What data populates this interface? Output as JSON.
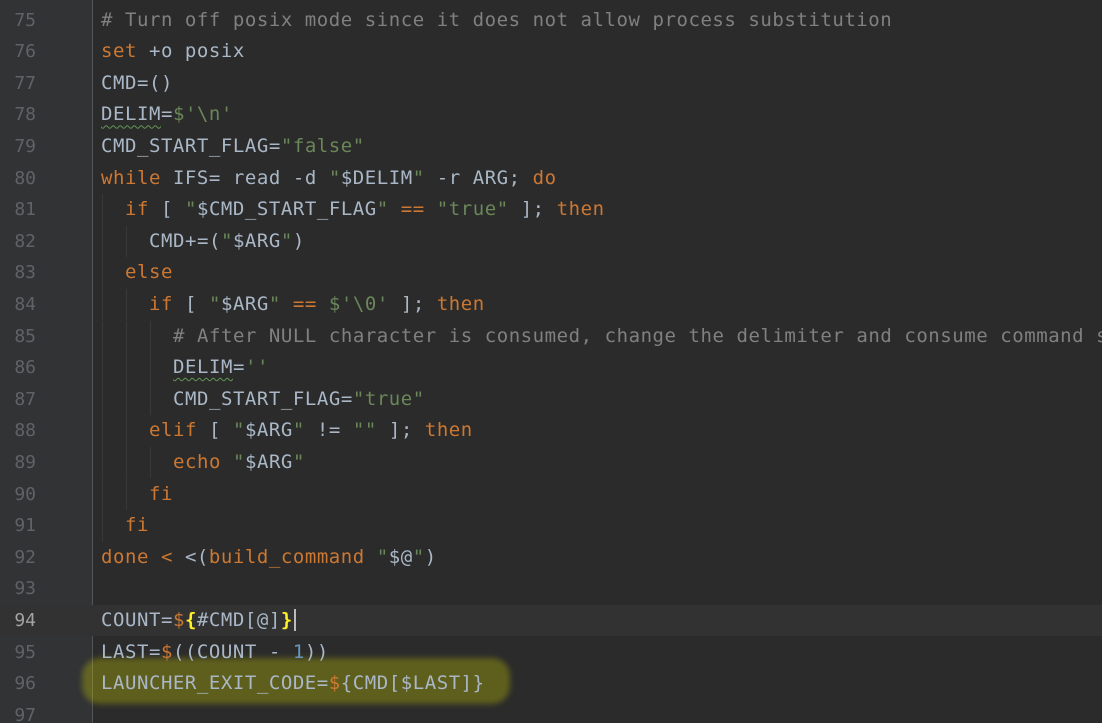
{
  "editor": {
    "lines": [
      {
        "num": "75",
        "indent": 0,
        "current": false,
        "tokens": [
          {
            "t": "# Turn off posix mode since it does not allow process substitution",
            "c": "comment"
          }
        ]
      },
      {
        "num": "76",
        "indent": 0,
        "current": false,
        "tokens": [
          {
            "t": "set",
            "c": "kw"
          },
          {
            "t": " +o posix",
            "c": "plain"
          }
        ]
      },
      {
        "num": "77",
        "indent": 0,
        "current": false,
        "tokens": [
          {
            "t": "CMD=()",
            "c": "plain"
          }
        ]
      },
      {
        "num": "78",
        "indent": 0,
        "current": false,
        "tokens": [
          {
            "t": "DELIM",
            "c": "warn"
          },
          {
            "t": "=",
            "c": "plain"
          },
          {
            "t": "$'\\n'",
            "c": "str"
          }
        ]
      },
      {
        "num": "79",
        "indent": 0,
        "current": false,
        "tokens": [
          {
            "t": "CMD_START_FLAG=",
            "c": "plain"
          },
          {
            "t": "\"false\"",
            "c": "str"
          }
        ]
      },
      {
        "num": "80",
        "indent": 0,
        "current": false,
        "tokens": [
          {
            "t": "while",
            "c": "kw"
          },
          {
            "t": " IFS= read -d ",
            "c": "plain"
          },
          {
            "t": "\"",
            "c": "str"
          },
          {
            "t": "$DELIM",
            "c": "plain"
          },
          {
            "t": "\"",
            "c": "str"
          },
          {
            "t": " -r ARG; ",
            "c": "plain"
          },
          {
            "t": "do",
            "c": "kw"
          }
        ]
      },
      {
        "num": "81",
        "indent": 1,
        "current": false,
        "tokens": [
          {
            "t": "if",
            "c": "kw"
          },
          {
            "t": " [ ",
            "c": "plain"
          },
          {
            "t": "\"",
            "c": "str"
          },
          {
            "t": "$CMD_START_FLAG",
            "c": "plain"
          },
          {
            "t": "\"",
            "c": "str"
          },
          {
            "t": " == ",
            "c": "kw"
          },
          {
            "t": "\"true\"",
            "c": "str"
          },
          {
            "t": " ]; ",
            "c": "plain"
          },
          {
            "t": "then",
            "c": "kw"
          }
        ]
      },
      {
        "num": "82",
        "indent": 2,
        "current": false,
        "tokens": [
          {
            "t": "CMD+=(",
            "c": "plain"
          },
          {
            "t": "\"",
            "c": "str"
          },
          {
            "t": "$ARG",
            "c": "plain"
          },
          {
            "t": "\"",
            "c": "str"
          },
          {
            "t": ")",
            "c": "plain"
          }
        ]
      },
      {
        "num": "83",
        "indent": 1,
        "current": false,
        "tokens": [
          {
            "t": "else",
            "c": "kw"
          }
        ]
      },
      {
        "num": "84",
        "indent": 2,
        "current": false,
        "tokens": [
          {
            "t": "if",
            "c": "kw"
          },
          {
            "t": " [ ",
            "c": "plain"
          },
          {
            "t": "\"",
            "c": "str"
          },
          {
            "t": "$ARG",
            "c": "plain"
          },
          {
            "t": "\"",
            "c": "str"
          },
          {
            "t": " == ",
            "c": "kw"
          },
          {
            "t": "$'\\0'",
            "c": "str"
          },
          {
            "t": " ]; ",
            "c": "plain"
          },
          {
            "t": "then",
            "c": "kw"
          }
        ]
      },
      {
        "num": "85",
        "indent": 3,
        "current": false,
        "tokens": [
          {
            "t": "# After NULL character is consumed, change the delimiter and consume command s",
            "c": "comment"
          }
        ]
      },
      {
        "num": "86",
        "indent": 3,
        "current": false,
        "tokens": [
          {
            "t": "DELIM",
            "c": "warn"
          },
          {
            "t": "=",
            "c": "plain"
          },
          {
            "t": "''",
            "c": "str"
          }
        ]
      },
      {
        "num": "87",
        "indent": 3,
        "current": false,
        "tokens": [
          {
            "t": "CMD_START_FLAG=",
            "c": "plain"
          },
          {
            "t": "\"true\"",
            "c": "str"
          }
        ]
      },
      {
        "num": "88",
        "indent": 2,
        "current": false,
        "tokens": [
          {
            "t": "elif",
            "c": "kw"
          },
          {
            "t": " [ ",
            "c": "plain"
          },
          {
            "t": "\"",
            "c": "str"
          },
          {
            "t": "$ARG",
            "c": "plain"
          },
          {
            "t": "\"",
            "c": "str"
          },
          {
            "t": " != ",
            "c": "plain"
          },
          {
            "t": "\"\"",
            "c": "str"
          },
          {
            "t": " ]; ",
            "c": "plain"
          },
          {
            "t": "then",
            "c": "kw"
          }
        ]
      },
      {
        "num": "89",
        "indent": 3,
        "current": false,
        "tokens": [
          {
            "t": "echo",
            "c": "kw"
          },
          {
            "t": " ",
            "c": "plain"
          },
          {
            "t": "\"",
            "c": "str"
          },
          {
            "t": "$ARG",
            "c": "plain"
          },
          {
            "t": "\"",
            "c": "str"
          }
        ]
      },
      {
        "num": "90",
        "indent": 2,
        "current": false,
        "tokens": [
          {
            "t": "fi",
            "c": "kw"
          }
        ]
      },
      {
        "num": "91",
        "indent": 1,
        "current": false,
        "tokens": [
          {
            "t": "fi",
            "c": "kw"
          }
        ]
      },
      {
        "num": "92",
        "indent": 0,
        "current": false,
        "tokens": [
          {
            "t": "done",
            "c": "kw"
          },
          {
            "t": " < ",
            "c": "kw"
          },
          {
            "t": "<(",
            "c": "plain"
          },
          {
            "t": "build_command",
            "c": "kw"
          },
          {
            "t": " ",
            "c": "plain"
          },
          {
            "t": "\"",
            "c": "str"
          },
          {
            "t": "$@",
            "c": "plain"
          },
          {
            "t": "\"",
            "c": "str"
          },
          {
            "t": ")",
            "c": "plain"
          }
        ]
      },
      {
        "num": "93",
        "indent": 0,
        "current": false,
        "tokens": []
      },
      {
        "num": "94",
        "indent": 0,
        "current": true,
        "tokens": [
          {
            "t": "COUNT=",
            "c": "plain"
          },
          {
            "t": "$",
            "c": "kw"
          },
          {
            "t": "{",
            "c": "brace"
          },
          {
            "t": "#CMD[@]",
            "c": "plain"
          },
          {
            "t": "}",
            "c": "brace"
          },
          {
            "t": "",
            "c": "caret"
          }
        ]
      },
      {
        "num": "95",
        "indent": 0,
        "current": false,
        "tokens": [
          {
            "t": "LAST=",
            "c": "plain"
          },
          {
            "t": "$",
            "c": "kw"
          },
          {
            "t": "((COUNT - ",
            "c": "plain"
          },
          {
            "t": "1",
            "c": "num"
          },
          {
            "t": "))",
            "c": "plain"
          }
        ]
      },
      {
        "num": "96",
        "indent": 0,
        "current": false,
        "tokens": [
          {
            "t": "LAUNCHER_EXIT_CODE=",
            "c": "plain"
          },
          {
            "t": "$",
            "c": "kw"
          },
          {
            "t": "{CMD[$LAST]}",
            "c": "plain"
          }
        ]
      },
      {
        "num": "97",
        "indent": 0,
        "current": false,
        "tokens": []
      }
    ]
  },
  "colors": {
    "background": "#2b2b2b",
    "gutter": "#313335",
    "keyword": "#cc7832",
    "string": "#6a8759",
    "comment": "#808080",
    "number": "#6897bb",
    "text": "#a9b7c6",
    "brace_match": "#ffef28",
    "highlight_marker": "#cdcd00"
  }
}
